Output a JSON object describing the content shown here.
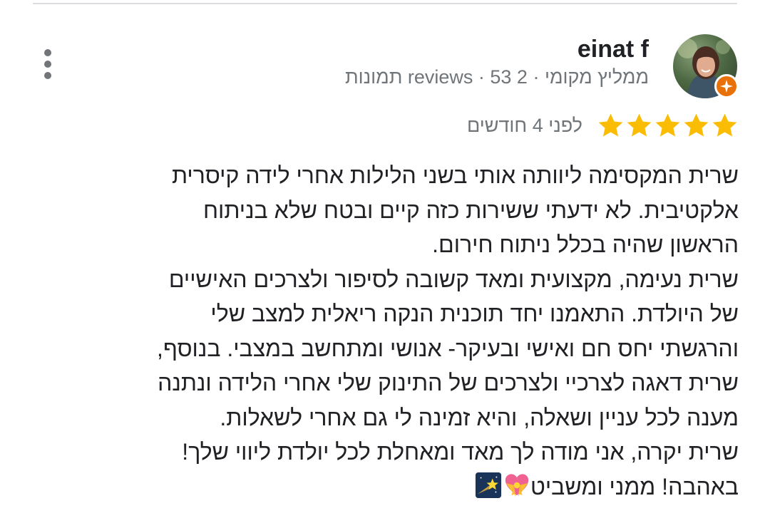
{
  "reviewer": {
    "name": "einat f",
    "meta": "ממליץ מקומי · 2 reviews · 53 תמונות"
  },
  "rating": {
    "stars": 5,
    "max_stars": 5,
    "date": "לפני 4 חודשים",
    "star_color": "#fbbc04"
  },
  "review": {
    "lines": [
      "שרית המקסימה ליוותה אותי בשני הלילות אחרי לידה קיסרית",
      "אלקטיבית. לא ידעתי ששירות כזה קיים ובטח שלא בניתוח",
      "הראשון שהיה בכלל ניתוח חירום.",
      "שרית נעימה, מקצועית ומאד קשובה לסיפור ולצרכים האישיים",
      "של היולדת. התאמנו יחד תוכנית הנקה ריאלית למצב שלי",
      "והרגשתי יחס חם ואישי ובעיקר- אנושי ומתחשב במצבי. בנוסף,",
      "שרית דאגה לצרכיי ולצרכים של התינוק שלי אחרי הלידה ונתנה",
      "מענה לכל עניין ושאלה, והיא זמינה לי גם אחרי לשאלות.",
      "שרית יקרה, אני מודה לך מאד ומאחלת לכל יולדת ליווי שלך!",
      "באהבה! ממני ומשביט"
    ],
    "emojis": [
      "heart-with-ribbon-emoji",
      "shooting-star-emoji"
    ]
  },
  "colors": {
    "divider": "#dadce0",
    "muted_text": "#70757a",
    "guide_badge": "#e8710a"
  }
}
